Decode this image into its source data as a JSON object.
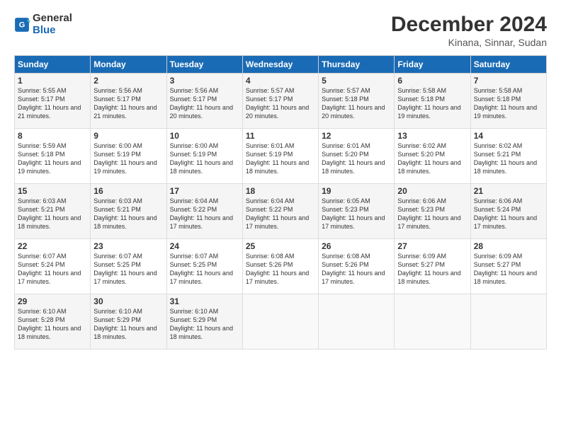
{
  "logo": {
    "general": "General",
    "blue": "Blue"
  },
  "title": "December 2024",
  "location": "Kinana, Sinnar, Sudan",
  "days_header": [
    "Sunday",
    "Monday",
    "Tuesday",
    "Wednesday",
    "Thursday",
    "Friday",
    "Saturday"
  ],
  "weeks": [
    [
      {
        "day": "1",
        "sunrise": "5:55 AM",
        "sunset": "5:17 PM",
        "daylight": "11 hours and 21 minutes."
      },
      {
        "day": "2",
        "sunrise": "5:56 AM",
        "sunset": "5:17 PM",
        "daylight": "11 hours and 21 minutes."
      },
      {
        "day": "3",
        "sunrise": "5:56 AM",
        "sunset": "5:17 PM",
        "daylight": "11 hours and 20 minutes."
      },
      {
        "day": "4",
        "sunrise": "5:57 AM",
        "sunset": "5:17 PM",
        "daylight": "11 hours and 20 minutes."
      },
      {
        "day": "5",
        "sunrise": "5:57 AM",
        "sunset": "5:18 PM",
        "daylight": "11 hours and 20 minutes."
      },
      {
        "day": "6",
        "sunrise": "5:58 AM",
        "sunset": "5:18 PM",
        "daylight": "11 hours and 19 minutes."
      },
      {
        "day": "7",
        "sunrise": "5:58 AM",
        "sunset": "5:18 PM",
        "daylight": "11 hours and 19 minutes."
      }
    ],
    [
      {
        "day": "8",
        "sunrise": "5:59 AM",
        "sunset": "5:18 PM",
        "daylight": "11 hours and 19 minutes."
      },
      {
        "day": "9",
        "sunrise": "6:00 AM",
        "sunset": "5:19 PM",
        "daylight": "11 hours and 19 minutes."
      },
      {
        "day": "10",
        "sunrise": "6:00 AM",
        "sunset": "5:19 PM",
        "daylight": "11 hours and 18 minutes."
      },
      {
        "day": "11",
        "sunrise": "6:01 AM",
        "sunset": "5:19 PM",
        "daylight": "11 hours and 18 minutes."
      },
      {
        "day": "12",
        "sunrise": "6:01 AM",
        "sunset": "5:20 PM",
        "daylight": "11 hours and 18 minutes."
      },
      {
        "day": "13",
        "sunrise": "6:02 AM",
        "sunset": "5:20 PM",
        "daylight": "11 hours and 18 minutes."
      },
      {
        "day": "14",
        "sunrise": "6:02 AM",
        "sunset": "5:21 PM",
        "daylight": "11 hours and 18 minutes."
      }
    ],
    [
      {
        "day": "15",
        "sunrise": "6:03 AM",
        "sunset": "5:21 PM",
        "daylight": "11 hours and 18 minutes."
      },
      {
        "day": "16",
        "sunrise": "6:03 AM",
        "sunset": "5:21 PM",
        "daylight": "11 hours and 18 minutes."
      },
      {
        "day": "17",
        "sunrise": "6:04 AM",
        "sunset": "5:22 PM",
        "daylight": "11 hours and 17 minutes."
      },
      {
        "day": "18",
        "sunrise": "6:04 AM",
        "sunset": "5:22 PM",
        "daylight": "11 hours and 17 minutes."
      },
      {
        "day": "19",
        "sunrise": "6:05 AM",
        "sunset": "5:23 PM",
        "daylight": "11 hours and 17 minutes."
      },
      {
        "day": "20",
        "sunrise": "6:06 AM",
        "sunset": "5:23 PM",
        "daylight": "11 hours and 17 minutes."
      },
      {
        "day": "21",
        "sunrise": "6:06 AM",
        "sunset": "5:24 PM",
        "daylight": "11 hours and 17 minutes."
      }
    ],
    [
      {
        "day": "22",
        "sunrise": "6:07 AM",
        "sunset": "5:24 PM",
        "daylight": "11 hours and 17 minutes."
      },
      {
        "day": "23",
        "sunrise": "6:07 AM",
        "sunset": "5:25 PM",
        "daylight": "11 hours and 17 minutes."
      },
      {
        "day": "24",
        "sunrise": "6:07 AM",
        "sunset": "5:25 PM",
        "daylight": "11 hours and 17 minutes."
      },
      {
        "day": "25",
        "sunrise": "6:08 AM",
        "sunset": "5:26 PM",
        "daylight": "11 hours and 17 minutes."
      },
      {
        "day": "26",
        "sunrise": "6:08 AM",
        "sunset": "5:26 PM",
        "daylight": "11 hours and 17 minutes."
      },
      {
        "day": "27",
        "sunrise": "6:09 AM",
        "sunset": "5:27 PM",
        "daylight": "11 hours and 18 minutes."
      },
      {
        "day": "28",
        "sunrise": "6:09 AM",
        "sunset": "5:27 PM",
        "daylight": "11 hours and 18 minutes."
      }
    ],
    [
      {
        "day": "29",
        "sunrise": "6:10 AM",
        "sunset": "5:28 PM",
        "daylight": "11 hours and 18 minutes."
      },
      {
        "day": "30",
        "sunrise": "6:10 AM",
        "sunset": "5:29 PM",
        "daylight": "11 hours and 18 minutes."
      },
      {
        "day": "31",
        "sunrise": "6:10 AM",
        "sunset": "5:29 PM",
        "daylight": "11 hours and 18 minutes."
      },
      null,
      null,
      null,
      null
    ]
  ]
}
